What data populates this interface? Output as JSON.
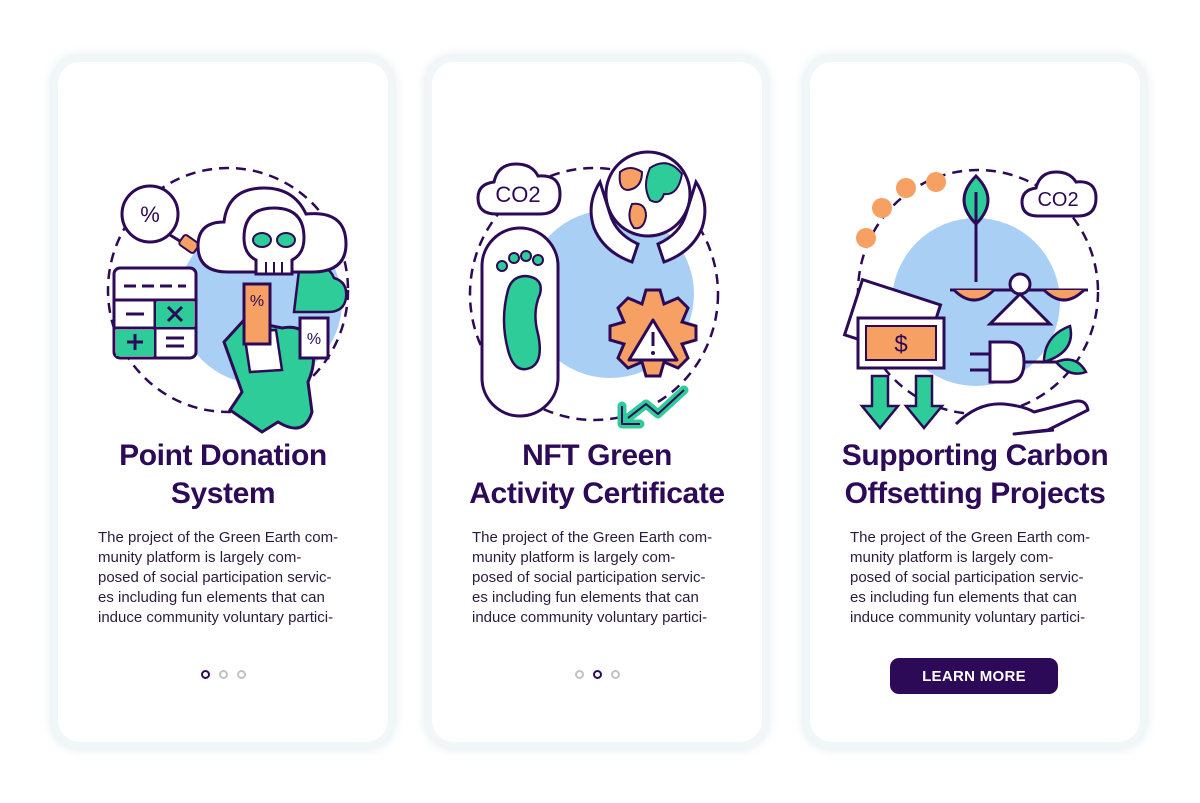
{
  "colors": {
    "title": "#2d0a57",
    "accent_green": "#2ecc99",
    "accent_orange": "#f6a063",
    "accent_blue": "#a9cff5",
    "outline": "#2d0a57",
    "dot_inactive": "#c2c2c2"
  },
  "screens": [
    {
      "title_lines": [
        "Point Donation",
        "System"
      ],
      "body_lines": [
        "The project of the Green Earth com-",
        "munity platform is largely com-",
        "posed of social participation servic-",
        "es including fun elements that can",
        "induce community voluntary partici-"
      ],
      "illustration_icons": [
        "percent-magnifier-icon",
        "skull-cloud-icon",
        "calculator-icon",
        "percent-tag-icon",
        "land-map-icon"
      ],
      "pagination": {
        "active_index": 0,
        "count": 3
      }
    },
    {
      "title_lines": [
        "NFT Green",
        "Activity Certificate"
      ],
      "body_lines": [
        "The project of the Green Earth com-",
        "munity platform is largely com-",
        "posed of social participation servic-",
        "es including fun elements that can",
        "induce community voluntary partici-"
      ],
      "co2_label": "CO2",
      "illustration_icons": [
        "co2-cloud-icon",
        "globe-hands-icon",
        "footprint-icon",
        "warning-gear-icon",
        "decline-arrow-icon"
      ],
      "pagination": {
        "active_index": 1,
        "count": 3
      }
    },
    {
      "title_lines": [
        "Supporting Carbon",
        "Offsetting Projects"
      ],
      "body_lines": [
        "The project of the Green Earth com-",
        "munity platform is largely com-",
        "posed of social participation servic-",
        "es including fun elements that can",
        "induce community voluntary partici-"
      ],
      "co2_label": "CO2",
      "dollar_sign": "$",
      "illustration_icons": [
        "coins-icon",
        "leaf-icon",
        "co2-cloud-icon",
        "balance-scale-icon",
        "money-bill-icon",
        "down-arrows-icon",
        "plug-icon",
        "hand-icon"
      ],
      "button_label": "LEARN MORE"
    }
  ]
}
